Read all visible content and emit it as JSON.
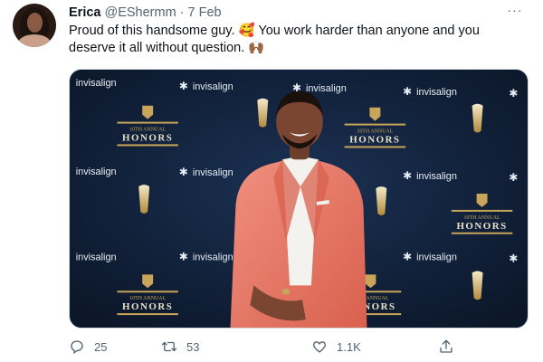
{
  "tweet": {
    "author_name": "Erica",
    "author_handle": "@EShermm",
    "separator": "·",
    "date": "7 Feb",
    "more_label": "···",
    "text_line1": "Proud of this handsome guy. 🥰 You work harder than anyone and you",
    "text_line2": "deserve it all without question. 🙌🏾"
  },
  "media": {
    "backdrop_brand": "invisalign",
    "honors_ordinal": "10TH ANNUAL",
    "honors_title": "HONORS"
  },
  "actions": {
    "reply_count": "25",
    "retweet_count": "53",
    "like_count": "1.1K"
  },
  "icons": [
    "reply-icon",
    "retweet-icon",
    "like-icon",
    "share-icon",
    "more-icon"
  ],
  "colors": {
    "backdrop": "#0f1d33",
    "suit": "#e87a6a",
    "gold": "#c9a55a",
    "text_secondary": "#536471"
  }
}
